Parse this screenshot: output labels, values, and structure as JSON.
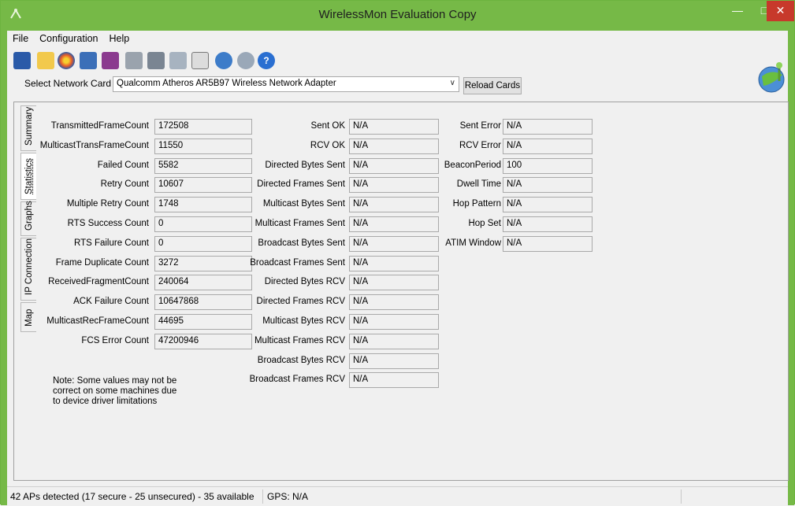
{
  "window": {
    "title": "WirelessMon Evaluation Copy"
  },
  "menu": [
    "File",
    "Configuration",
    "Help"
  ],
  "toolbar_icons": [
    "save-icon",
    "open-folder-icon",
    "target-icon",
    "network-card-icon",
    "network-card-2-icon",
    "export-icon",
    "print-icon",
    "checklist-icon",
    "clipboard-icon",
    "globe-icon",
    "globe-2-icon",
    "help-icon"
  ],
  "network_card": {
    "label": "Select Network Card",
    "value": "Qualcomm Atheros AR5B97 Wireless Network Adapter",
    "reload_label": "Reload Cards"
  },
  "tabs": [
    "Summary",
    "Statistics",
    "Graphs",
    "IP Connection",
    "Map"
  ],
  "stats_col1": [
    {
      "label": "TransmittedFrameCount",
      "value": "172508"
    },
    {
      "label": "MulticastTransFrameCount",
      "value": "11550"
    },
    {
      "label": "Failed Count",
      "value": "5582"
    },
    {
      "label": "Retry Count",
      "value": "10607"
    },
    {
      "label": "Multiple Retry Count",
      "value": "1748"
    },
    {
      "label": "RTS Success Count",
      "value": "0"
    },
    {
      "label": "RTS Failure Count",
      "value": "0"
    },
    {
      "label": "Frame Duplicate Count",
      "value": "3272"
    },
    {
      "label": "ReceivedFragmentCount",
      "value": "240064"
    },
    {
      "label": "ACK Failure Count",
      "value": "10647868"
    },
    {
      "label": "MulticastRecFrameCount",
      "value": "44695"
    },
    {
      "label": "FCS Error Count",
      "value": "47200946"
    }
  ],
  "stats_col2": [
    {
      "label": "Sent OK",
      "value": "N/A"
    },
    {
      "label": "RCV OK",
      "value": "N/A"
    },
    {
      "label": "Directed Bytes Sent",
      "value": "N/A"
    },
    {
      "label": "Directed Frames Sent",
      "value": "N/A"
    },
    {
      "label": "Multicast Bytes Sent",
      "value": "N/A"
    },
    {
      "label": "Multicast Frames Sent",
      "value": "N/A"
    },
    {
      "label": "Broadcast Bytes Sent",
      "value": "N/A"
    },
    {
      "label": "Broadcast Frames Sent",
      "value": "N/A"
    },
    {
      "label": "Directed Bytes RCV",
      "value": "N/A"
    },
    {
      "label": "Directed Frames RCV",
      "value": "N/A"
    },
    {
      "label": "Multicast Bytes RCV",
      "value": "N/A"
    },
    {
      "label": "Multicast Frames RCV",
      "value": "N/A"
    },
    {
      "label": "Broadcast Bytes RCV",
      "value": "N/A"
    },
    {
      "label": "Broadcast Frames RCV",
      "value": "N/A"
    }
  ],
  "stats_col3": [
    {
      "label": "Sent Error",
      "value": "N/A"
    },
    {
      "label": "RCV Error",
      "value": "N/A"
    },
    {
      "label": "BeaconPeriod",
      "value": "100"
    },
    {
      "label": "Dwell Time",
      "value": "N/A"
    },
    {
      "label": "Hop Pattern",
      "value": "N/A"
    },
    {
      "label": "Hop Set",
      "value": "N/A"
    },
    {
      "label": "ATIM Window",
      "value": "N/A"
    }
  ],
  "note": "Note: Some values may not be correct on some machines due to device driver limitations",
  "status": {
    "aps": "42 APs detected (17 secure - 25 unsecured) - 35 available",
    "gps": "GPS: N/A"
  },
  "colors": {
    "title_bar": "#76b947",
    "close_button": "#c7392b"
  }
}
